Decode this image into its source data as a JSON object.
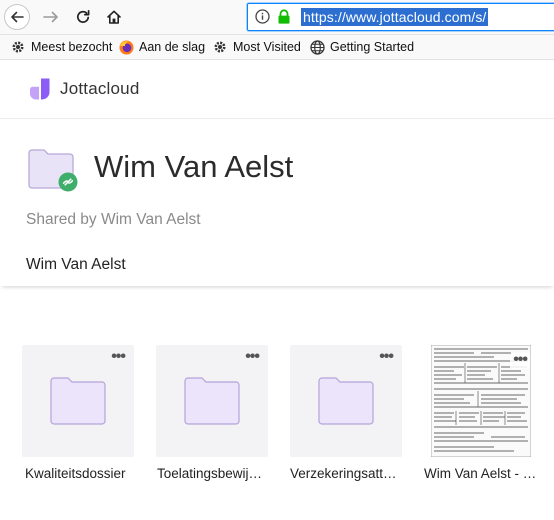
{
  "browser": {
    "url": "https://www.jottacloud.com/s/",
    "accent": "#0a84ff",
    "selection_color": "#2c6fd1"
  },
  "bookmarks": [
    {
      "label": "Meest bezocht",
      "icon": "gear-icon"
    },
    {
      "label": "Aan de slag",
      "icon": "firefox-icon"
    },
    {
      "label": "Most Visited",
      "icon": "gear-icon"
    },
    {
      "label": "Getting Started",
      "icon": "globe-icon"
    }
  ],
  "site": {
    "brand": "Jottacloud",
    "brand_colors": [
      "#b58cf3",
      "#8b5cf6"
    ]
  },
  "share": {
    "title": "Wim Van Aelst",
    "shared_by": "Shared by Wim Van Aelst",
    "owner": "Wim Van Aelst",
    "link_badge_color": "#3fae6a"
  },
  "files": [
    {
      "name": "Kwaliteitsdossier",
      "type": "folder"
    },
    {
      "name": "Toelatingsbewij…",
      "type": "folder"
    },
    {
      "name": "Verzekeringsatt…",
      "type": "folder"
    },
    {
      "name": "Wim Van Aelst - …",
      "type": "document"
    }
  ],
  "more_label": "•••"
}
